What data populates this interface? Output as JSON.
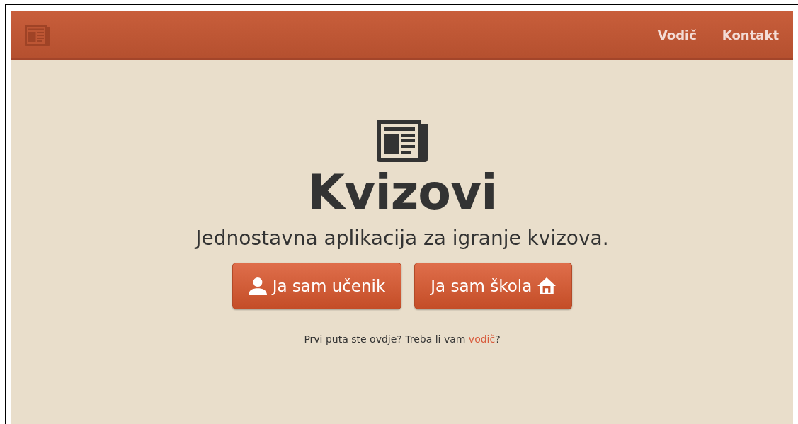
{
  "nav": {
    "links": [
      {
        "label": "Vodič"
      },
      {
        "label": "Kontakt"
      }
    ]
  },
  "hero": {
    "title": "Kvizovi",
    "subtitle": "Jednostavna aplikacija za igranje kvizova.",
    "buttons": [
      {
        "label": "Ja sam učenik",
        "kind": "student"
      },
      {
        "label": "Ja sam škola",
        "kind": "school"
      }
    ],
    "hint": {
      "before": "Prvi puta ste ovdje? Treba li vam ",
      "link": "vodič",
      "after": "?"
    }
  }
}
